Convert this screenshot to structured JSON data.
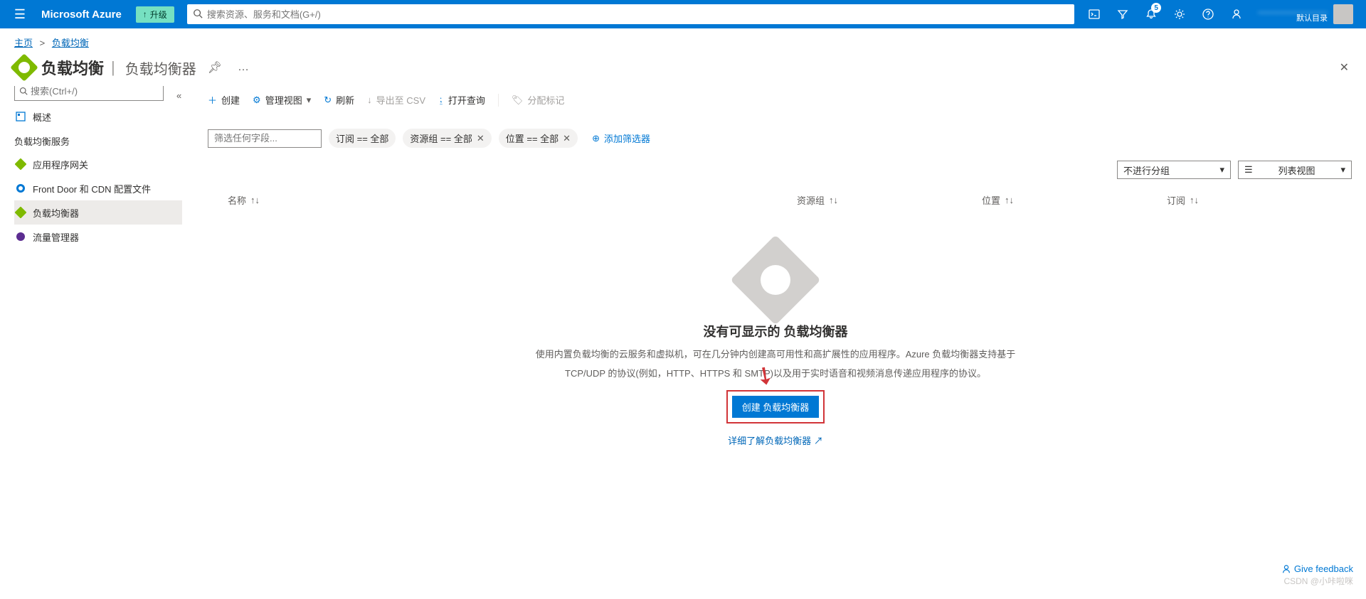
{
  "header": {
    "brand": "Microsoft Azure",
    "upgrade": "升级",
    "search_placeholder": "搜索资源、服务和文档(G+/)",
    "notification_count": "5",
    "user_line2": "默认目录"
  },
  "breadcrumb": {
    "home": "主页",
    "lb": "负载均衡"
  },
  "page": {
    "title": "负载均衡",
    "subtitle": "负载均衡器"
  },
  "sidebar": {
    "search_placeholder": "搜索(Ctrl+/)",
    "overview": "概述",
    "section": "负载均衡服务",
    "items": [
      {
        "label": "应用程序网关"
      },
      {
        "label": "Front Door 和 CDN 配置文件"
      },
      {
        "label": "负载均衡器"
      },
      {
        "label": "流量管理器"
      }
    ]
  },
  "toolbar": {
    "create": "创建",
    "manage_view": "管理视图",
    "refresh": "刷新",
    "export_csv": "导出至 CSV",
    "open_query": "打开查询",
    "assign_tags": "分配标记"
  },
  "filters": {
    "filter_placeholder": "筛选任何字段...",
    "sub": "订阅 == 全部",
    "rg": "资源组 == 全部",
    "loc": "位置 == 全部",
    "add": "添加筛选器"
  },
  "view": {
    "group": "不进行分组",
    "list": "列表视图"
  },
  "columns": {
    "name": "名称",
    "rg": "资源组",
    "loc": "位置",
    "sub": "订阅"
  },
  "empty": {
    "heading": "没有可显示的 负载均衡器",
    "desc1": "使用内置负载均衡的云服务和虚拟机，可在几分钟内创建高可用性和高扩展性的应用程序。Azure 负载均衡器支持基于",
    "desc2": "TCP/UDP 的协议(例如，HTTP、HTTPS 和 SMTP)以及用于实时语音和视频消息传递应用程序的协议。",
    "create": "创建 负载均衡器",
    "learn": "详细了解负载均衡器"
  },
  "feedback": "Give feedback",
  "watermark": "CSDN @小咔啦咪"
}
